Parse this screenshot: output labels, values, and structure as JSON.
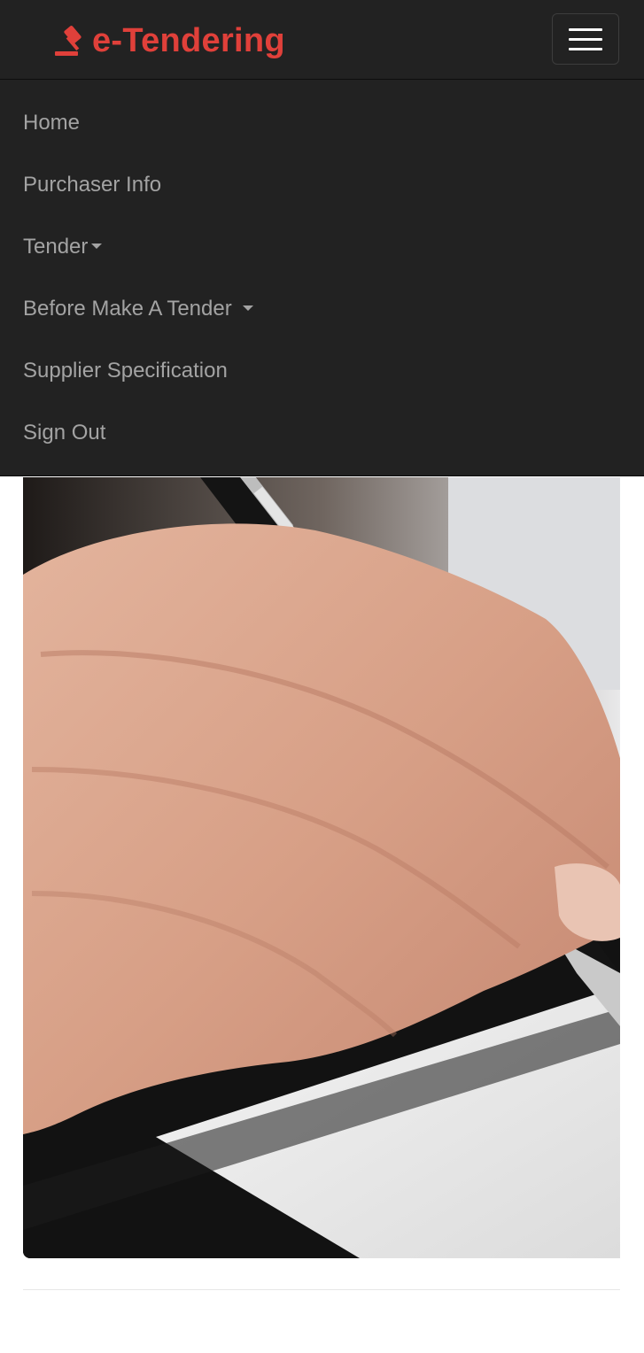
{
  "brand": {
    "name": "e-Tendering",
    "icon": "gavel-icon",
    "color": "#e0403a"
  },
  "navbar": {
    "toggle_icon": "hamburger-menu-icon",
    "background": "#222222",
    "items": [
      {
        "label": "Home",
        "has_dropdown": false
      },
      {
        "label": "Purchaser Info",
        "has_dropdown": false
      },
      {
        "label": "Tender",
        "has_dropdown": true
      },
      {
        "label": "Before Make A Tender",
        "has_dropdown": true
      },
      {
        "label": "Supplier Specification",
        "has_dropdown": false
      },
      {
        "label": "Sign Out",
        "has_dropdown": false
      }
    ]
  },
  "hero": {
    "image": "hand-writing-with-pen-photo"
  }
}
